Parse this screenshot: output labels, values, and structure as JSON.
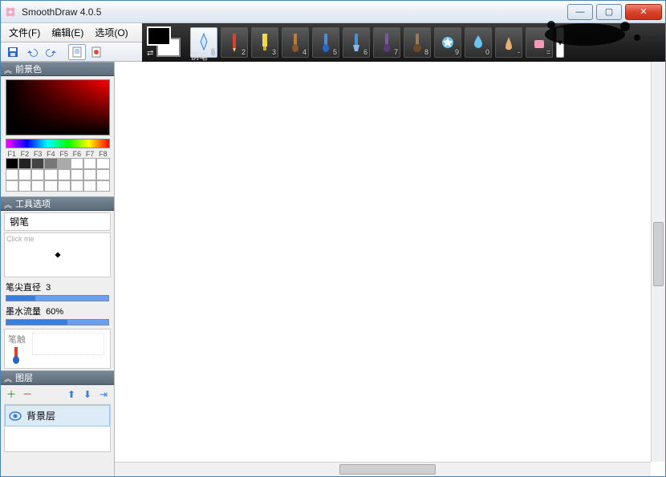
{
  "app": {
    "title": "SmoothDraw 4.0.5"
  },
  "menus": {
    "file": "文件(F)",
    "edit": "编辑(E)",
    "options": "选项(O)"
  },
  "toolbar": {
    "save": "save",
    "undo": "undo",
    "redo": "redo",
    "new": "new",
    "open": "open"
  },
  "tool_strip": {
    "selected_label": "钢笔",
    "numbers": [
      "1",
      "2",
      "3",
      "4",
      "5",
      "6",
      "7",
      "8",
      "9",
      "0",
      "-",
      "="
    ]
  },
  "panels": {
    "foreground": {
      "title": "前景色",
      "swatch_labels": [
        "F1",
        "F2",
        "F3",
        "F4",
        "F5",
        "F6",
        "F7",
        "F8"
      ]
    },
    "tool_options": {
      "title": "工具选项",
      "name": "钢笔",
      "curve_hint": "Click me",
      "tip_diameter_label": "笔尖直径",
      "tip_diameter_value": "3",
      "ink_flow_label": "墨水流量",
      "ink_flow_value": "60%",
      "brush_label": "笔触"
    },
    "layers": {
      "title": "图层",
      "layer_name": "背景层"
    }
  }
}
